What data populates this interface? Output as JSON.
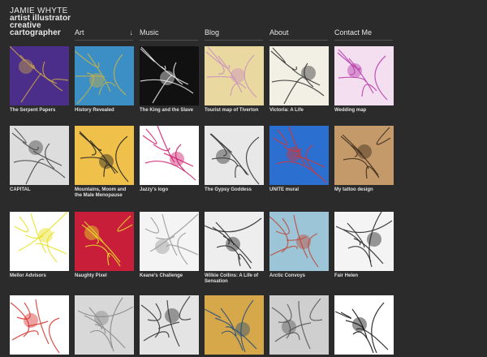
{
  "header": {
    "name_line1": "JAMIE WHYTE",
    "name_line2": "artist illustrator",
    "name_line3": "creative",
    "name_line4": "cartographer"
  },
  "nav": [
    {
      "label": "Art",
      "arrow": "↓"
    },
    {
      "label": "Music"
    },
    {
      "label": "Blog"
    },
    {
      "label": "About"
    },
    {
      "label": "Contact Me"
    }
  ],
  "gallery": [
    {
      "caption": "The Serpent Papers",
      "icon": "bird-collage-thumbnail",
      "colors": [
        "#4a2e8a",
        "#c7a24a"
      ]
    },
    {
      "caption": "History Revealed",
      "icon": "coastal-map-thumbnail",
      "colors": [
        "#3b8fc4",
        "#c9b24a"
      ]
    },
    {
      "caption": "The King and the Slave",
      "icon": "bw-map-thumbnail",
      "colors": [
        "#111111",
        "#eeeeee"
      ]
    },
    {
      "caption": "Tourist map of Tiverton",
      "icon": "town-map-thumbnail",
      "colors": [
        "#e9d9a0",
        "#c98fbf"
      ]
    },
    {
      "caption": "Victoria: A Life",
      "icon": "portrait-map-thumbnail",
      "colors": [
        "#f2efe4",
        "#333333"
      ]
    },
    {
      "caption": "Wedding map",
      "icon": "pink-map-thumbnail",
      "colors": [
        "#f3dff0",
        "#b53aa8"
      ]
    },
    {
      "caption": "CAPITAL",
      "icon": "street-map-thumbnail",
      "colors": [
        "#dddddd",
        "#444444"
      ]
    },
    {
      "caption": "Mountains, Moom and the Male Menopause",
      "icon": "book-cover-thumbnail",
      "colors": [
        "#f0c14a",
        "#222222"
      ]
    },
    {
      "caption": "Jazzy's logo",
      "icon": "logo-thumbnail",
      "colors": [
        "#ffffff",
        "#cc1a6b"
      ]
    },
    {
      "caption": "The Gypsy Goddess",
      "icon": "territory-map-thumbnail",
      "colors": [
        "#e8e8e8",
        "#333333"
      ]
    },
    {
      "caption": "UNITE mural",
      "icon": "mural-thumbnail",
      "colors": [
        "#2b6fd1",
        "#d8342e"
      ]
    },
    {
      "caption": "My tattoo design",
      "icon": "tattoo-thumbnail",
      "colors": [
        "#c49a6a",
        "#3a2a1a"
      ]
    },
    {
      "caption": "Mellor Advisors",
      "icon": "lettering-thumbnail",
      "colors": [
        "#ffffff",
        "#e8e01a"
      ]
    },
    {
      "caption": "Naughty Pixel",
      "icon": "pixel-logo-thumbnail",
      "colors": [
        "#c81e3a",
        "#e6e02a"
      ]
    },
    {
      "caption": "Keane's Challenge",
      "icon": "sketch-map-thumbnail",
      "colors": [
        "#f4f4f4",
        "#999999"
      ]
    },
    {
      "caption": "Wilkie Collins: A Life of Sensation",
      "icon": "city-plan-thumbnail",
      "colors": [
        "#eeeeee",
        "#222222"
      ]
    },
    {
      "caption": "Arctic Convoys",
      "icon": "arctic-map-thumbnail",
      "colors": [
        "#9cc6d8",
        "#c0483a"
      ]
    },
    {
      "caption": "Fair Helen",
      "icon": "illustrated-map-thumbnail",
      "colors": [
        "#f4f4f4",
        "#222222"
      ]
    },
    {
      "caption": "",
      "icon": "sketch-thumbnail",
      "colors": [
        "#ffffff",
        "#d8342e"
      ]
    },
    {
      "caption": "",
      "icon": "grey-thumbnail",
      "colors": [
        "#d8d8d8",
        "#888888"
      ]
    },
    {
      "caption": "",
      "icon": "plane-map-thumbnail",
      "colors": [
        "#e4e4e4",
        "#333333"
      ]
    },
    {
      "caption": "",
      "icon": "antique-map-thumbnail",
      "colors": [
        "#d6a84a",
        "#2a4f7a"
      ]
    },
    {
      "caption": "",
      "icon": "engraving-thumbnail",
      "colors": [
        "#cfcfcf",
        "#555555"
      ]
    },
    {
      "caption": "",
      "icon": "bw-illustration-thumbnail",
      "colors": [
        "#ffffff",
        "#111111"
      ]
    }
  ]
}
